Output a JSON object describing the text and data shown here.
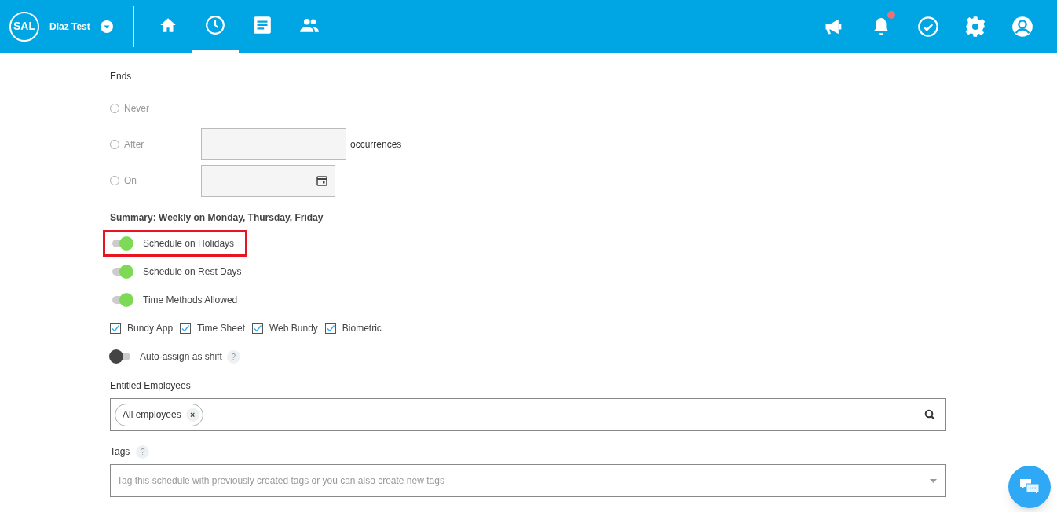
{
  "header": {
    "logo": "SAL",
    "account": "Diaz Test",
    "nav": [
      {
        "selected": false
      },
      {
        "selected": true
      },
      {
        "selected": false
      },
      {
        "selected": false
      }
    ],
    "actions": [
      {
        "has_notification": false
      },
      {
        "has_notification": true
      },
      {
        "has_notification": false
      },
      {
        "has_notification": false
      },
      {
        "has_notification": false
      }
    ]
  },
  "ends": {
    "label": "Ends",
    "options": [
      {
        "label": "Never",
        "selected": false,
        "kind": "plain"
      },
      {
        "label": "After",
        "selected": false,
        "kind": "number",
        "suffix": "occurrences"
      },
      {
        "label": "On",
        "selected": false,
        "kind": "date"
      }
    ]
  },
  "summary": "Summary: Weekly on Monday, Thursday, Friday",
  "toggles": [
    {
      "label": "Schedule on Holidays",
      "on": true,
      "highlighted": true
    },
    {
      "label": "Schedule on Rest Days",
      "on": true,
      "highlighted": false
    },
    {
      "label": "Time Methods Allowed",
      "on": true,
      "highlighted": false
    }
  ],
  "time_methods": [
    {
      "label": "Bundy App",
      "checked": true
    },
    {
      "label": "Time Sheet",
      "checked": true
    },
    {
      "label": "Web Bundy",
      "checked": true
    },
    {
      "label": "Biometric",
      "checked": true
    }
  ],
  "auto_assign": {
    "label": "Auto-assign as shift",
    "on": false,
    "help": "?"
  },
  "entitled_employees": {
    "label": "Entitled Employees",
    "chips": [
      "All employees"
    ],
    "remove": "×"
  },
  "tags": {
    "label": "Tags",
    "help": "?",
    "placeholder": "Tag this schedule with previously created tags or you can also create new tags"
  }
}
